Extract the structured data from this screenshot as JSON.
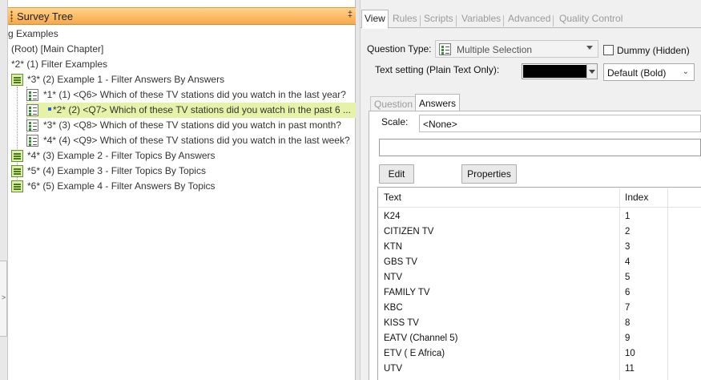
{
  "tree": {
    "title": "Survey Tree",
    "pin_glyph": "‡",
    "rows": [
      {
        "label": "g Examples"
      },
      {
        "label": "(Root) [Main Chapter]"
      },
      {
        "label": "*2* (1) Filter Examples"
      },
      {
        "label": "*3* (2) Example 1 - Filter Answers By Answers"
      },
      {
        "label": "*1* (1) <Q6> Which of these TV stations did you watch in the last year?"
      },
      {
        "label": "*2* (2) <Q7> Which of these TV stations did you watch in the past 6 ..."
      },
      {
        "label": "*3* (3) <Q8> Which of these TV stations did you watch in past month?"
      },
      {
        "label": "*4* (4) <Q9> Which of these TV stations did you watch in the last week?"
      },
      {
        "label": "*4* (3) Example 2 - Filter Topics By Answers"
      },
      {
        "label": "*5* (4) Example 3 - Filter Topics By Topics"
      },
      {
        "label": "*6* (5) Example 4 - Filter Answers By Topics"
      }
    ]
  },
  "tabs": [
    "View",
    "Rules",
    "Scripts",
    "Variables",
    "Advanced",
    "Quality Control"
  ],
  "question": {
    "type_label": "Question Type:",
    "type_value": "Multiple Selection",
    "dummy_label": "Dummy (Hidden)",
    "text_setting_label": "Text setting (Plain Text Only):",
    "text_color": "#000000",
    "font_style": "Default (Bold)"
  },
  "inner_tabs": [
    "Question",
    "Answers"
  ],
  "answers": {
    "scale_label": "Scale:",
    "scale_value": "<None>",
    "text_value": "",
    "edit_label": "Edit",
    "properties_label": "Properties",
    "columns": [
      "Text",
      "Index"
    ],
    "rows": [
      {
        "text": "K24",
        "index": "1"
      },
      {
        "text": "CITIZEN TV",
        "index": "2"
      },
      {
        "text": "KTN",
        "index": "3"
      },
      {
        "text": "GBS TV",
        "index": "4"
      },
      {
        "text": "NTV",
        "index": "5"
      },
      {
        "text": "FAMILY TV",
        "index": "6"
      },
      {
        "text": "KBC",
        "index": "7"
      },
      {
        "text": "KISS TV",
        "index": "8"
      },
      {
        "text": "EATV (Channel 5)",
        "index": "9"
      },
      {
        "text": "ETV ( E Africa)",
        "index": "10"
      },
      {
        "text": "UTV",
        "index": "11"
      }
    ]
  },
  "gutter_arrow": ">"
}
